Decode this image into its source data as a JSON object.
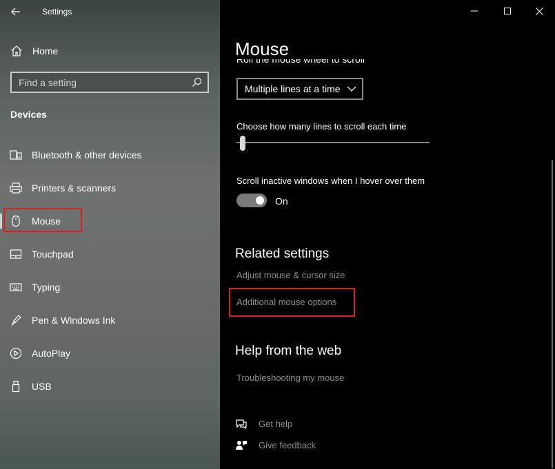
{
  "window": {
    "app_title": "Settings"
  },
  "sidebar": {
    "home_label": "Home",
    "search_placeholder": "Find a setting",
    "section_title": "Devices",
    "items": [
      {
        "label": "Bluetooth & other devices",
        "icon": "bluetooth-devices-icon"
      },
      {
        "label": "Printers & scanners",
        "icon": "printer-icon"
      },
      {
        "label": "Mouse",
        "icon": "mouse-icon",
        "active": true
      },
      {
        "label": "Touchpad",
        "icon": "touchpad-icon"
      },
      {
        "label": "Typing",
        "icon": "keyboard-icon"
      },
      {
        "label": "Pen & Windows Ink",
        "icon": "pen-icon"
      },
      {
        "label": "AutoPlay",
        "icon": "autoplay-icon"
      },
      {
        "label": "USB",
        "icon": "usb-icon"
      }
    ]
  },
  "main": {
    "page_title": "Mouse",
    "scroll_label": "Roll the mouse wheel to scroll",
    "scroll_dropdown_value": "Multiple lines at a time",
    "lines_label": "Choose how many lines to scroll each time",
    "lines_slider_level": 0.02,
    "inactive_label": "Scroll inactive windows when I hover over them",
    "inactive_toggle_state": "On",
    "related_title": "Related settings",
    "related_links": [
      "Adjust mouse & cursor size",
      "Additional mouse options"
    ],
    "help_title": "Help from the web",
    "help_links": [
      "Troubleshooting my mouse"
    ],
    "footer_links": [
      {
        "label": "Get help",
        "icon": "get-help-icon"
      },
      {
        "label": "Give feedback",
        "icon": "feedback-icon"
      }
    ]
  },
  "colors": {
    "highlight": "#e0201e",
    "link_gray": "#8e8e8e",
    "main_bg": "#000000"
  }
}
